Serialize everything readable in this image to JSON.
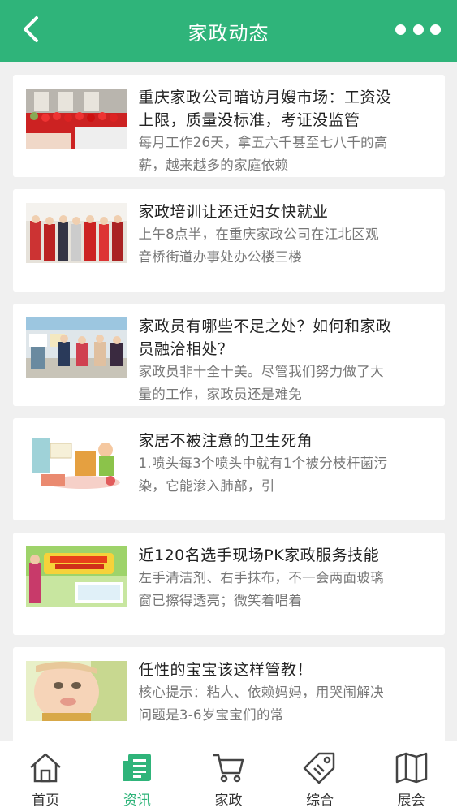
{
  "header": {
    "title": "家政动态",
    "back_icon": "chevron-left-icon",
    "more_icon": "more-dots-icon"
  },
  "colors": {
    "brand": "#2fb47a",
    "headline": "#222222",
    "summary": "#777777"
  },
  "articles": [
    {
      "headline": "重庆家政公司暗访月嫂市场：工资没上限，质量没标准，考证没监管",
      "summary": "每月工作26天，拿五六千甚至七八千的高薪，越来越多的家庭依赖"
    },
    {
      "headline": "家政培训让还迁妇女快就业",
      "summary": "上午8点半，在重庆家政公司在江北区观音桥街道办事处办公楼三楼"
    },
    {
      "headline": "家政员有哪些不足之处？如何和家政员融洽相处？",
      "summary": "家政员非十全十美。尽管我们努力做了大量的工作，家政员还是难免"
    },
    {
      "headline": "家居不被注意的卫生死角",
      "summary": "1.喷头每3个喷头中就有1个被分枝杆菌污染，它能渗入肺部，引"
    },
    {
      "headline": "近120名选手现场PK家政服务技能",
      "summary": "左手清洁剂、右手抹布，不一会两面玻璃窗已擦得透亮；微笑着唱着"
    },
    {
      "headline": "任性的宝宝该这样管教！",
      "summary": "核心提示：粘人、依赖妈妈，用哭闹解决问题是3-6岁宝宝们的常"
    }
  ],
  "tabs": [
    {
      "label": "首页",
      "icon": "home-icon",
      "active": false
    },
    {
      "label": "资讯",
      "icon": "news-icon",
      "active": true
    },
    {
      "label": "家政",
      "icon": "cart-icon",
      "active": false
    },
    {
      "label": "综合",
      "icon": "tag-icon",
      "active": false
    },
    {
      "label": "展会",
      "icon": "map-icon",
      "active": false
    }
  ]
}
